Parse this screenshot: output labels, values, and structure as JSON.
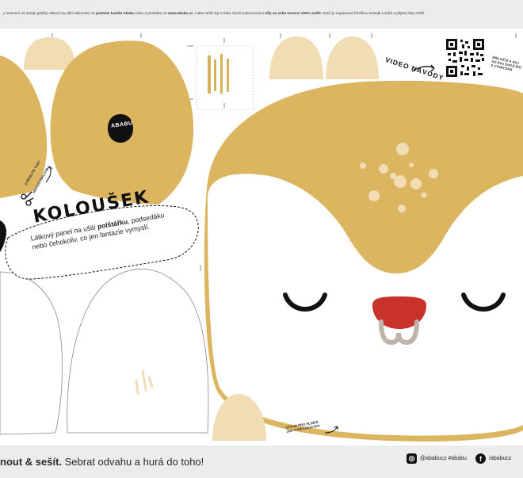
{
  "topbar": {
    "text_a": "y omezení od okraje grafiky. Návod na ušití naleznete na ",
    "text_b": "youtube kanálu Ababu",
    "text_c": " nebo a produktu na ",
    "text_d": "www.ababu.cz",
    "text_e": ". Látka může být z tisku různě pobroucená a ",
    "text_f": "díly na sebe nemusí 100% sedět",
    "text_g": ". Stačí je napasovat želečkou sesadit k sobě a půjdou lépe sešít."
  },
  "label": {
    "title": "KOLOUŠEK",
    "desc_a": "Látkový panel na ušití ",
    "desc_b": "polštářku",
    "desc_c": ", podsedáku",
    "desc_d": "nebo čehokoliv, co jen fantazie vymyslí."
  },
  "notes": {
    "video": "VIDEO NÁVODY",
    "qr_note_1": "PŘILOŽTE A NAJ",
    "qr_note_2": "DO ŠVU SVOJÍ ŠITÍ",
    "qr_note_3": "S VÝHRYSÁM",
    "opening_1": "OTVOR PRO PLNĚNÍ",
    "opening_2": "JDE VYNECHÁNÍ ŠITÍ",
    "cut_1": "STŘÍHEJTE TADY",
    "cut_2": "NEODSTŘIHUJTE",
    "brand_logo": "ABABU",
    "rotated_note": "nezapomeňte"
  },
  "footer": {
    "slogan_a": "nout & sešít.",
    "slogan_b": " Sebrat odvahu a hurá do toho!",
    "instagram": "@ababucz  #ababu",
    "facebook": "/ababucz"
  },
  "icons": {
    "instagram": "instagram-icon",
    "facebook": "facebook-icon",
    "scissors": "scissors-icon",
    "qr": "qr-code-icon",
    "arrow": "curved-arrow-icon"
  },
  "colors": {
    "fur": "#dcb560",
    "light_beige": "#f1dcb4",
    "nose": "#c8322a",
    "mouth": "#c2b3a8",
    "bar_gray": "#ececec",
    "ink": "#111111"
  }
}
